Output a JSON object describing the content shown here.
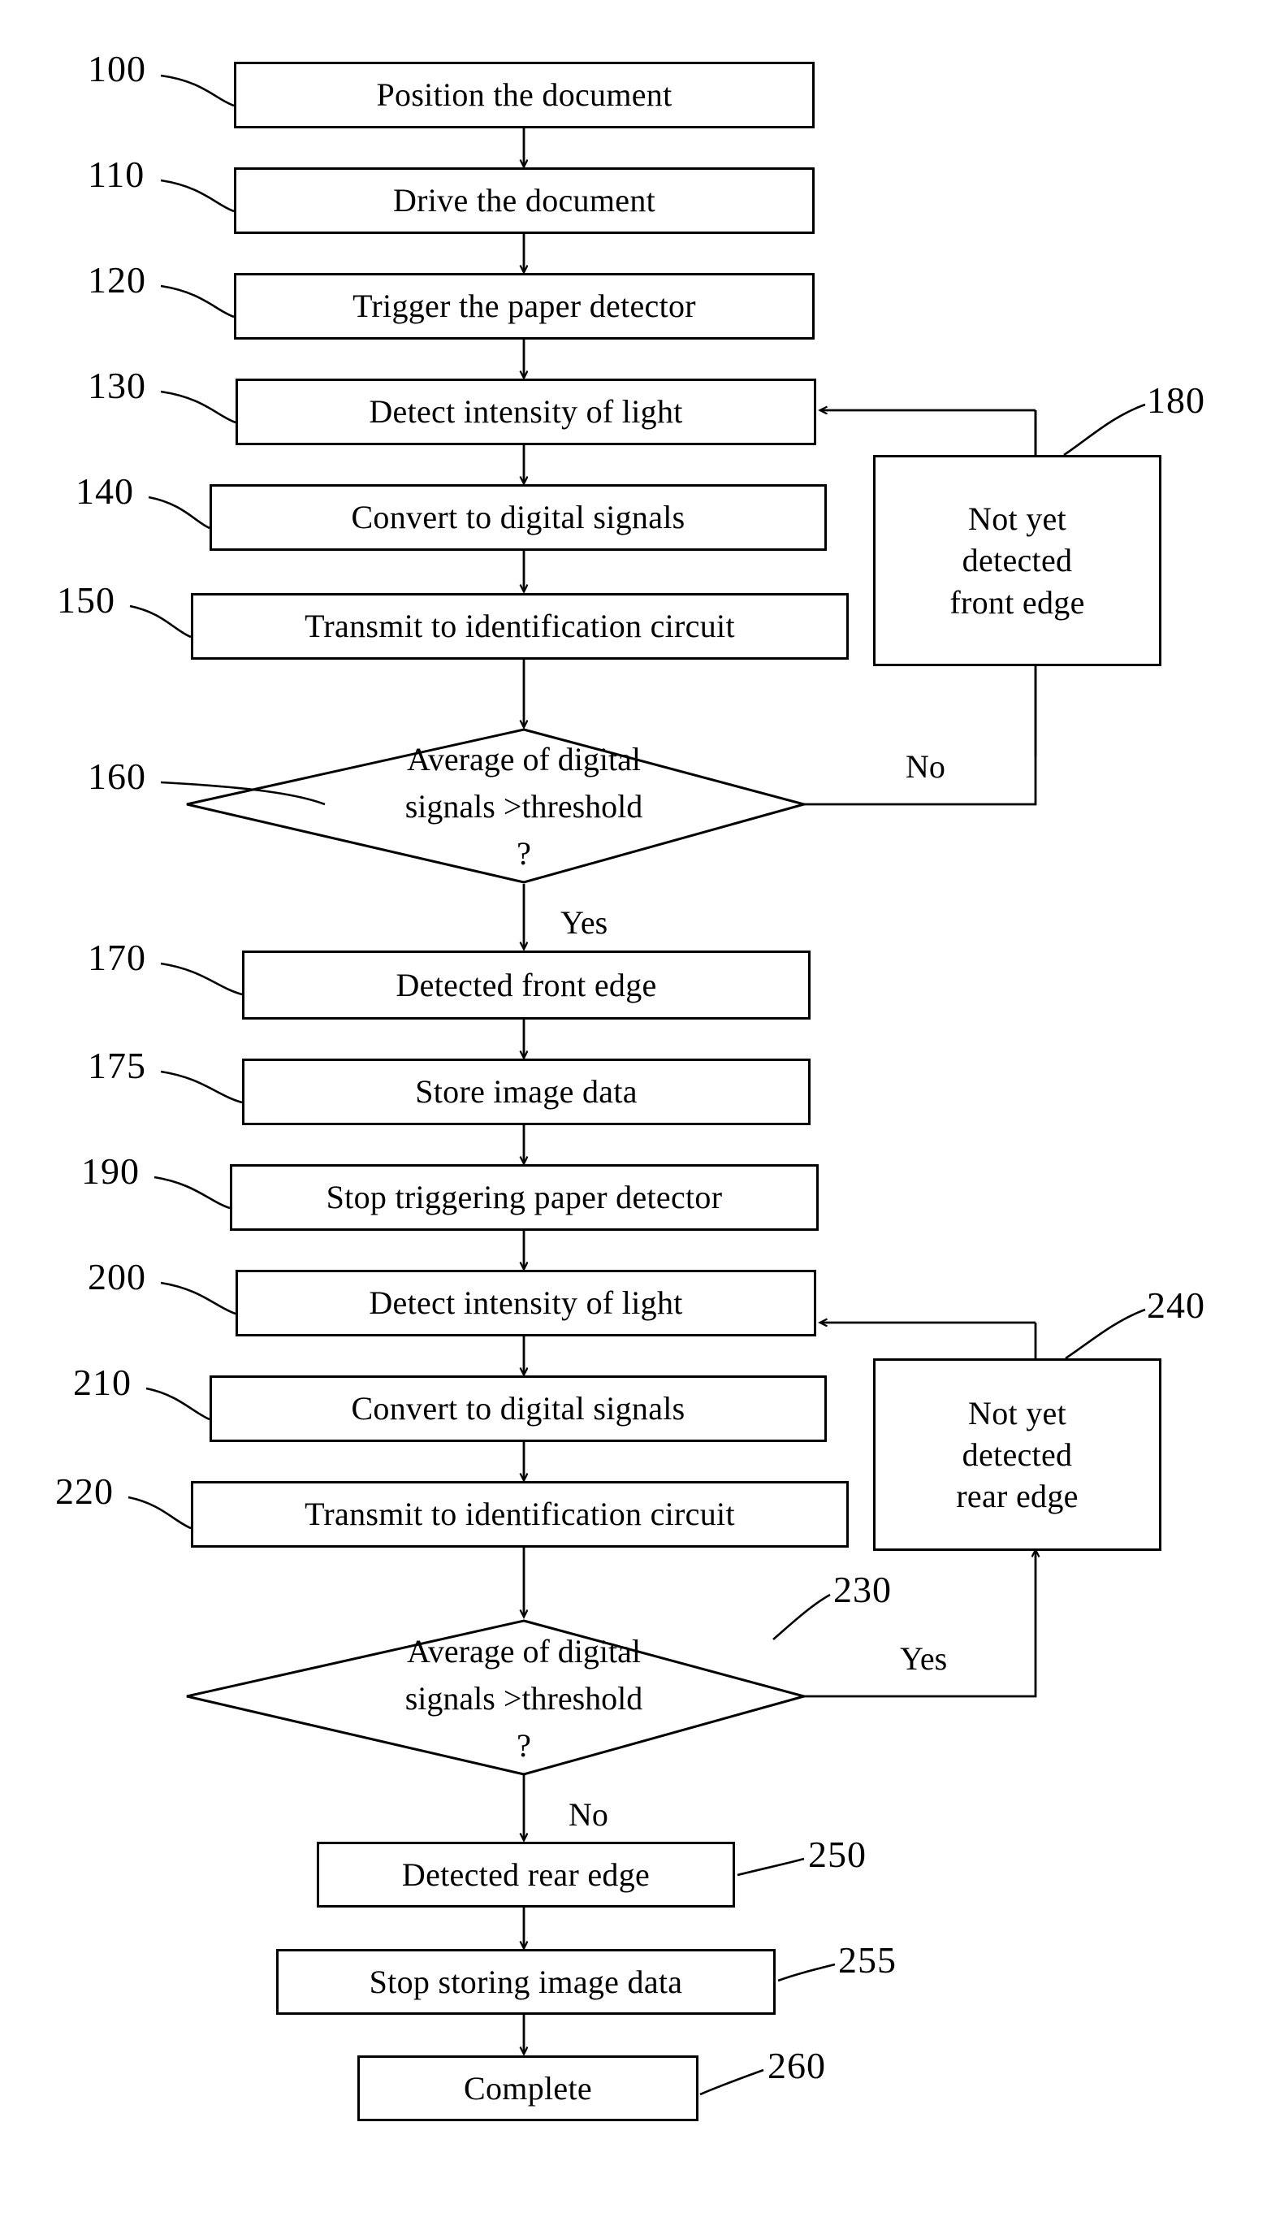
{
  "figure": {
    "type": "flowchart",
    "title": "",
    "orientation": "top-to-bottom"
  },
  "nodes": [
    {
      "ref": "100",
      "label": "Position the document",
      "shape": "process"
    },
    {
      "ref": "110",
      "label": "Drive the document",
      "shape": "process"
    },
    {
      "ref": "120",
      "label": "Trigger the paper detector",
      "shape": "process"
    },
    {
      "ref": "130",
      "label": "Detect intensity of light",
      "shape": "process"
    },
    {
      "ref": "140",
      "label": "Convert to digital signals",
      "shape": "process"
    },
    {
      "ref": "150",
      "label": "Transmit to identification circuit",
      "shape": "process"
    },
    {
      "ref": "160",
      "label": "Average of digital signals >threshold ?",
      "shape": "decision",
      "line1": "Average of digital",
      "line2": "signals >threshold",
      "line3": "?"
    },
    {
      "ref": "180",
      "label": "Not yet detected front edge",
      "shape": "process",
      "line1": "Not yet",
      "line2": "detected",
      "line3": "front edge"
    },
    {
      "ref": "170",
      "label": "Detected front edge",
      "shape": "process"
    },
    {
      "ref": "175",
      "label": "Store image data",
      "shape": "process"
    },
    {
      "ref": "190",
      "label": "Stop triggering paper detector",
      "shape": "process"
    },
    {
      "ref": "200",
      "label": "Detect intensity of light",
      "shape": "process"
    },
    {
      "ref": "210",
      "label": "Convert to digital signals",
      "shape": "process"
    },
    {
      "ref": "220",
      "label": "Transmit to identification circuit",
      "shape": "process"
    },
    {
      "ref": "230",
      "label": "Average of digital signals >threshold ?",
      "shape": "decision",
      "line1": "Average of digital",
      "line2": "signals >threshold",
      "line3": "?"
    },
    {
      "ref": "240",
      "label": "Not yet detected rear edge",
      "shape": "process",
      "line1": "Not yet",
      "line2": "detected",
      "line3": "rear edge"
    },
    {
      "ref": "250",
      "label": "Detected rear edge",
      "shape": "process"
    },
    {
      "ref": "255",
      "label": "Stop storing image data",
      "shape": "process"
    },
    {
      "ref": "260",
      "label": "Complete",
      "shape": "process"
    }
  ],
  "edge_labels": {
    "decision_160_no": "No",
    "decision_160_yes": "Yes",
    "decision_230_yes": "Yes",
    "decision_230_no": "No"
  },
  "colors": {
    "stroke": "#000000",
    "fill": "#ffffff",
    "text": "#000000"
  }
}
